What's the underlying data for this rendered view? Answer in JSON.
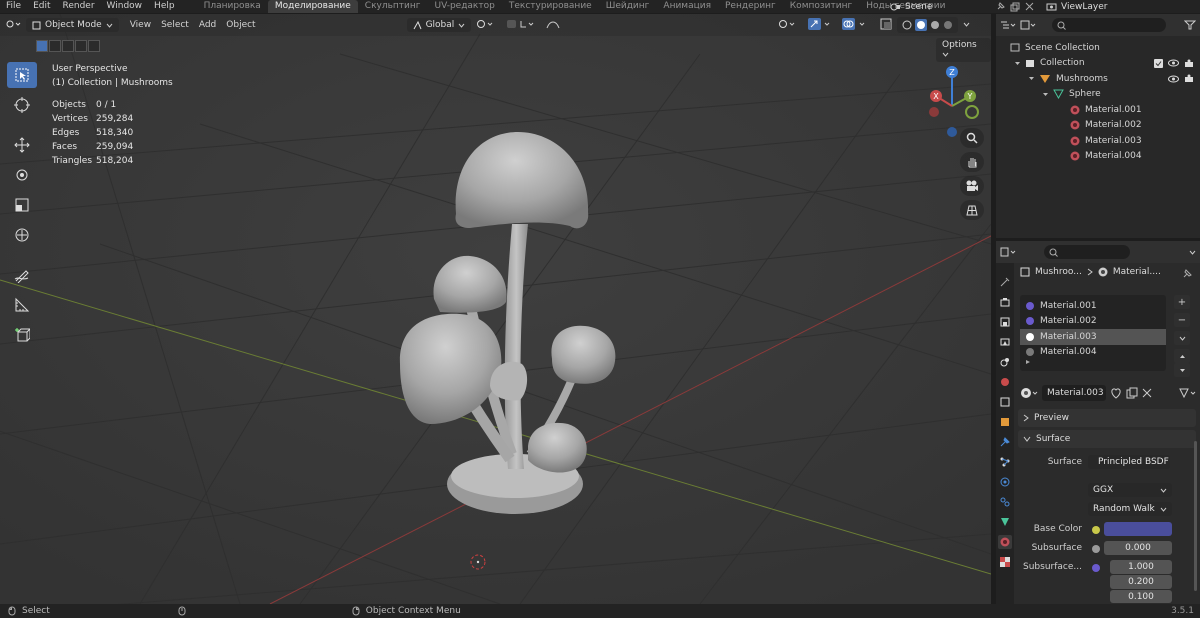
{
  "menu": [
    "File",
    "Edit",
    "Render",
    "Window",
    "Help"
  ],
  "workspaces": [
    {
      "label": "Планировка",
      "active": false
    },
    {
      "label": "Моделирование",
      "active": true
    },
    {
      "label": "Скульптинг",
      "active": false
    },
    {
      "label": "UV-редактор",
      "active": false
    },
    {
      "label": "Текстурирование",
      "active": false
    },
    {
      "label": "Шейдинг",
      "active": false
    },
    {
      "label": "Анимация",
      "active": false
    },
    {
      "label": "Рендеринг",
      "active": false
    },
    {
      "label": "Композитинг",
      "active": false
    },
    {
      "label": "Ноды геометрии",
      "active": false
    }
  ],
  "scene": {
    "name": "Scene"
  },
  "view_layer": {
    "name": "ViewLayer"
  },
  "viewport": {
    "mode": "Object Mode",
    "menus": [
      "View",
      "Select",
      "Add",
      "Object"
    ],
    "transform_orientation": "Global",
    "options_label": "Options",
    "info": {
      "perspective": "User Perspective",
      "collection_path": "(1) Collection | Mushrooms",
      "stats": [
        {
          "label": "Objects",
          "value": "0 / 1"
        },
        {
          "label": "Vertices",
          "value": "259,284"
        },
        {
          "label": "Edges",
          "value": "518,340"
        },
        {
          "label": "Faces",
          "value": "259,094"
        },
        {
          "label": "Triangles",
          "value": "518,204"
        }
      ]
    },
    "gizmo_axes": {
      "z": "Z",
      "y": "Y",
      "x": "X"
    }
  },
  "status_bar": {
    "select": "Select",
    "context_menu": "Object Context Menu",
    "version": "3.5.1"
  },
  "outliner": {
    "rows": [
      {
        "label": "Scene Collection",
        "indent": 0
      },
      {
        "label": "Collection",
        "indent": 1
      },
      {
        "label": "Mushrooms",
        "indent": 2
      },
      {
        "label": "Sphere",
        "indent": 3
      },
      {
        "label": "Material.001",
        "indent": 4
      },
      {
        "label": "Material.002",
        "indent": 4
      },
      {
        "label": "Material.003",
        "indent": 4
      },
      {
        "label": "Material.004",
        "indent": 4
      }
    ]
  },
  "properties": {
    "breadcrumb": {
      "object": "Mushroo...",
      "material": "Material...."
    },
    "slots": [
      {
        "label": "Material.001",
        "color": "#6a5acd",
        "selected": false
      },
      {
        "label": "Material.002",
        "color": "#6a5acd",
        "selected": false
      },
      {
        "label": "Material.003",
        "color": "#ffffff",
        "selected": true
      },
      {
        "label": "Material.004",
        "color": "#7a7a7a",
        "selected": false
      }
    ],
    "active_material": "Material.003",
    "panels": {
      "preview": "Preview",
      "surface": "Surface"
    },
    "surface": {
      "surface_label": "Surface",
      "surface_value": "Principled BSDF",
      "distribution": "GGX",
      "subsurface_method": "Random Walk",
      "base_color_label": "Base Color",
      "base_color": "#4a4e9c",
      "subsurface_label": "Subsurface",
      "subsurface_value": "0.000",
      "subsurface_radius_label": "Subsurface...",
      "subsurface_radius": [
        "1.000",
        "0.200",
        "0.100"
      ]
    }
  },
  "colors": {
    "accent": "#4772b3",
    "background": "#3a3a3a",
    "x_axis": "#c84b4b",
    "y_axis": "#7ea23e",
    "z_axis": "#3f7fd6"
  }
}
